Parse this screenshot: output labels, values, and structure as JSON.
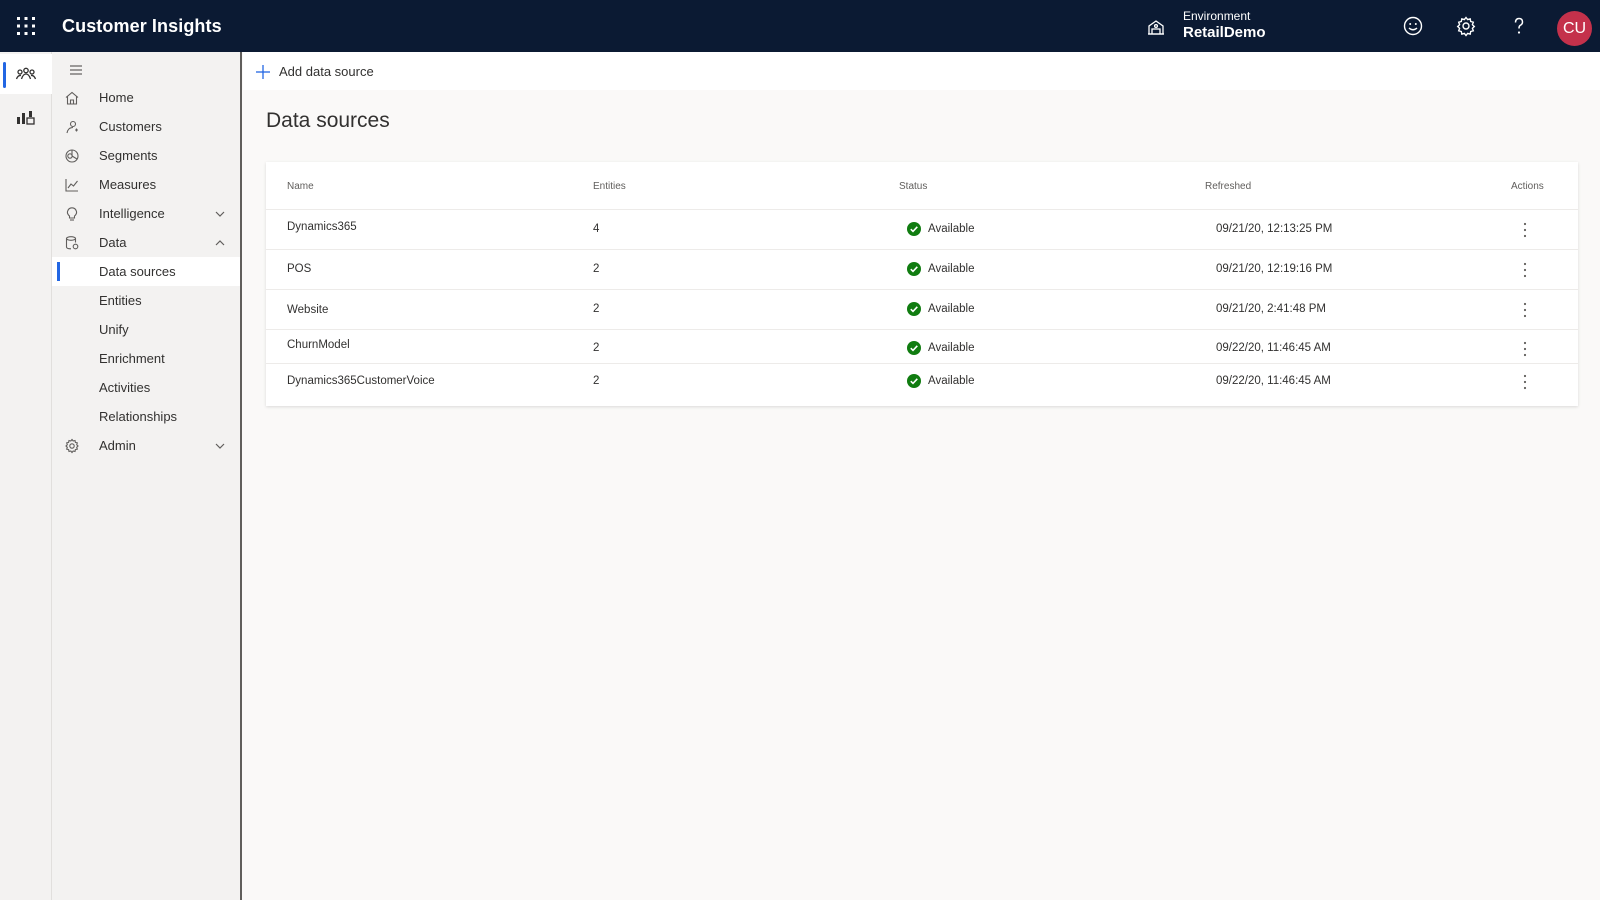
{
  "app": {
    "title": "Customer Insights"
  },
  "environment": {
    "label": "Environment",
    "name": "RetailDemo"
  },
  "user": {
    "initials": "CU"
  },
  "icons": {
    "waffle": "app-launcher-icon",
    "environment": "environment-icon",
    "feedback": "smiley-icon",
    "settings": "gear-icon",
    "help": "question-icon"
  },
  "colors": {
    "topbar": "#0b1a33",
    "accent": "#2266e3",
    "avatar": "#c4314b",
    "status_ok": "#107c10"
  },
  "sidebar": {
    "items": [
      {
        "label": "Home",
        "icon": "home-icon"
      },
      {
        "label": "Customers",
        "icon": "customers-icon"
      },
      {
        "label": "Segments",
        "icon": "segments-icon"
      },
      {
        "label": "Measures",
        "icon": "measures-icon"
      },
      {
        "label": "Intelligence",
        "icon": "lightbulb-icon"
      },
      {
        "label": "Data",
        "icon": "database-icon"
      },
      {
        "label": "Data sources"
      },
      {
        "label": "Entities"
      },
      {
        "label": "Unify"
      },
      {
        "label": "Enrichment"
      },
      {
        "label": "Activities"
      },
      {
        "label": "Relationships"
      },
      {
        "label": "Admin",
        "icon": "gear-icon"
      }
    ]
  },
  "toolbar": {
    "add_label": "Add data source"
  },
  "main": {
    "title": "Data sources"
  },
  "table": {
    "columns": [
      "Name",
      "Entities",
      "Status",
      "Refreshed",
      "Actions"
    ],
    "rows": [
      {
        "name": "Dynamics365",
        "entities": "4",
        "status": "Available",
        "refreshed": "09/21/20, 12:13:25 PM"
      },
      {
        "name": "POS",
        "entities": "2",
        "status": "Available",
        "refreshed": "09/21/20, 12:19:16 PM"
      },
      {
        "name": "Website",
        "entities": "2",
        "status": "Available",
        "refreshed": "09/21/20, 2:41:48 PM"
      },
      {
        "name": "ChurnModel",
        "entities": "2",
        "status": "Available",
        "refreshed": "09/22/20, 11:46:45 AM"
      },
      {
        "name": "Dynamics365CustomerVoice",
        "entities": "2",
        "status": "Available",
        "refreshed": "09/22/20, 11:46:45 AM"
      }
    ]
  }
}
